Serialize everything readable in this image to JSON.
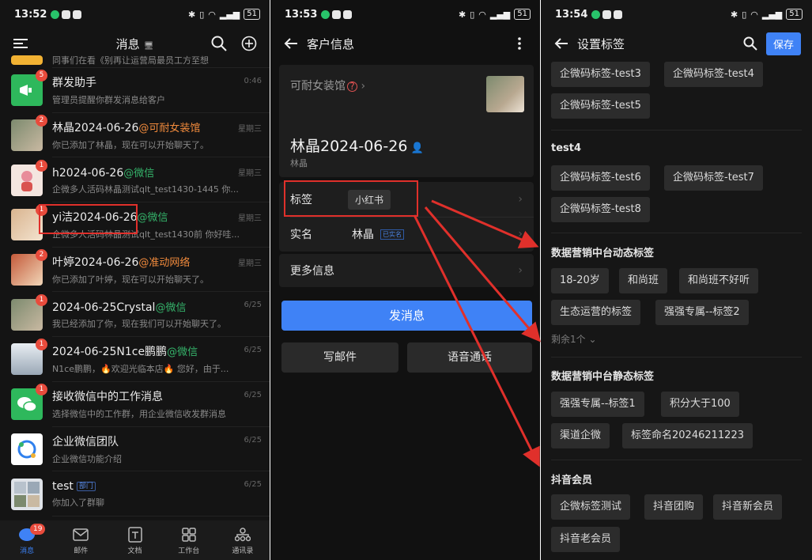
{
  "panel1": {
    "status": {
      "time": "13:52",
      "battery": "51"
    },
    "title": "消息",
    "chats": [
      {
        "name": "",
        "preview": "同事们在看《别再让运营局最员工方至想",
        "time": ""
      },
      {
        "name": "群发助手",
        "preview": "管理员提醒你群发消息给客户",
        "time": "0:46",
        "badge": "5"
      },
      {
        "name": "林晶2024-06-26",
        "tag": "@可耐女装馆",
        "preview": "你已添加了林晶，现在可以开始聊天了。",
        "time": "星期三",
        "badge": "2"
      },
      {
        "name": "h2024-06-26",
        "tag": "@微信",
        "preview": "企微多人活码林晶测试qlt_test1430-1445 你...",
        "time": "星期三",
        "badge": "1"
      },
      {
        "name": "yi洁2024-06-26",
        "tag": "@微信",
        "preview": "企微多人活码林晶测试qlt_test1430前 你好哇...",
        "time": "星期三",
        "badge": "1"
      },
      {
        "name": "叶婷2024-06-26",
        "tag": "@准动网络",
        "preview": "你已添加了叶婷，现在可以开始聊天了。",
        "time": "星期三",
        "badge": "2"
      },
      {
        "name": "2024-06-25Crystal",
        "tag": "@微信",
        "preview": "我已经添加了你，现在我们可以开始聊天了。",
        "time": "6/25",
        "badge": "1"
      },
      {
        "name": "2024-06-25N1ce鹏鹏",
        "tag": "@微信",
        "preview": "N1ce鹏鹏，🔥欢迎光临本店🔥 您好，由于...",
        "time": "6/25",
        "badge": "1"
      },
      {
        "name": "接收微信中的工作消息",
        "preview": "选择微信中的工作群，用企业微信收发群消息",
        "time": "6/25",
        "badge": "1"
      },
      {
        "name": "企业微信团队",
        "preview": "企业微信功能介绍",
        "time": "6/25"
      },
      {
        "name": "test",
        "dept": "部门",
        "preview": "你加入了群聊",
        "time": "6/25"
      }
    ],
    "nav": [
      {
        "label": "消息",
        "badge": "19"
      },
      {
        "label": "邮件"
      },
      {
        "label": "文档"
      },
      {
        "label": "工作台"
      },
      {
        "label": "通讯录"
      }
    ]
  },
  "panel2": {
    "status": {
      "time": "13:53",
      "battery": "51"
    },
    "title": "客户信息",
    "company": "可耐女装馆",
    "customer_name": "林晶2024-06-26",
    "customer_sub": "林晶",
    "label_row": {
      "label": "标签",
      "chip": "小红书"
    },
    "realname_row": {
      "label": "实名",
      "value": "林晶",
      "verified": "已实名"
    },
    "more_row": {
      "label": "更多信息"
    },
    "send_button": "发消息",
    "email_button": "写邮件",
    "voice_button": "语音通话"
  },
  "panel3": {
    "status": {
      "time": "13:54",
      "battery": "51"
    },
    "title": "设置标签",
    "save": "保存",
    "groups": {
      "g0": {
        "chips": [
          "企微码标签-test3",
          "企微码标签-test4",
          "企微码标签-test5"
        ]
      },
      "g1": {
        "title": "test4",
        "chips": [
          "企微码标签-test6",
          "企微码标签-test7",
          "企微码标签-test8"
        ]
      },
      "g2": {
        "title": "数据营销中台动态标签",
        "chips": [
          "18-20岁",
          "和尚班",
          "和尚班不好听",
          "生态运营的标签",
          "强强专属--标签2"
        ],
        "more": "剩余1个"
      },
      "g3": {
        "title": "数据营销中台静态标签",
        "chips": [
          "强强专属--标签1",
          "积分大于100",
          "渠道企微",
          "标签命名20246211223"
        ]
      },
      "g4": {
        "title": "抖音会员",
        "chips": [
          "企微标签测试",
          "抖音团购",
          "抖音新会员",
          "抖音老会员"
        ]
      }
    }
  },
  "colors": {
    "accent": "#3f82f6",
    "annotation": "#e0302b",
    "badge": "#e84b3c",
    "tag_green": "#35b36a",
    "tag_orange": "#f08a3c"
  }
}
